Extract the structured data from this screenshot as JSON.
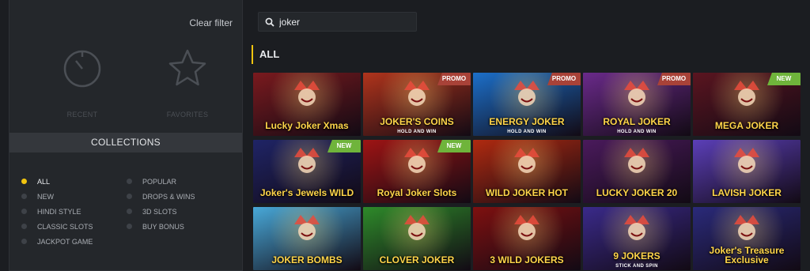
{
  "sidebar": {
    "clear_filter": "Clear filter",
    "shortcuts": [
      {
        "label": "RECENT",
        "icon": "stopwatch-icon"
      },
      {
        "label": "FAVORITES",
        "icon": "star-icon"
      }
    ],
    "collections_title": "COLLECTIONS",
    "collections_left": [
      "ALL",
      "NEW",
      "HINDI STYLE",
      "CLASSIC SLOTS",
      "JACKPOT GAME"
    ],
    "collections_right": [
      "POPULAR",
      "DROPS & WINS",
      "3D SLOTS",
      "BUY BONUS"
    ],
    "active_collection": "ALL",
    "accent": "#f1c40f"
  },
  "search": {
    "value": "joker",
    "placeholder": ""
  },
  "section_title": "ALL",
  "games": [
    {
      "title": "Lucky Joker Xmas",
      "sub": "",
      "badge": "",
      "bg": "#7a1a1e"
    },
    {
      "title": "JOKER'S COINS",
      "sub": "HOLD AND WIN",
      "badge": "PROMO",
      "bg": "#b0341c"
    },
    {
      "title": "ENERGY JOKER",
      "sub": "HOLD AND WIN",
      "badge": "PROMO",
      "bg": "#1c6fc9"
    },
    {
      "title": "ROYAL JOKER",
      "sub": "HOLD AND WIN",
      "badge": "PROMO",
      "bg": "#6a2a8a"
    },
    {
      "title": "MEGA JOKER",
      "sub": "",
      "badge": "NEW",
      "bg": "#5a1520"
    },
    {
      "title": "Joker's Jewels WILD",
      "sub": "",
      "badge": "NEW",
      "bg": "#1f2466"
    },
    {
      "title": "Royal Joker Slots",
      "sub": "",
      "badge": "NEW",
      "bg": "#9e1414"
    },
    {
      "title": "WILD JOKER HOT",
      "sub": "",
      "badge": "",
      "bg": "#b02a10"
    },
    {
      "title": "LUCKY JOKER 20",
      "sub": "",
      "badge": "",
      "bg": "#4a1a5c"
    },
    {
      "title": "LAVISH JOKER",
      "sub": "",
      "badge": "",
      "bg": "#5b3fb8"
    },
    {
      "title": "JOKER BOMBS",
      "sub": "",
      "badge": "",
      "bg": "#48a8d8"
    },
    {
      "title": "CLOVER JOKER",
      "sub": "",
      "badge": "",
      "bg": "#2e8a2a"
    },
    {
      "title": "3 WILD JOKERS",
      "sub": "",
      "badge": "",
      "bg": "#7e1010"
    },
    {
      "title": "9 JOKERS",
      "sub": "STICK AND SPIN",
      "badge": "",
      "bg": "#3a2a8a"
    },
    {
      "title": "Joker's Treasure Exclusive",
      "sub": "",
      "badge": "",
      "bg": "#2a2a7a"
    }
  ]
}
